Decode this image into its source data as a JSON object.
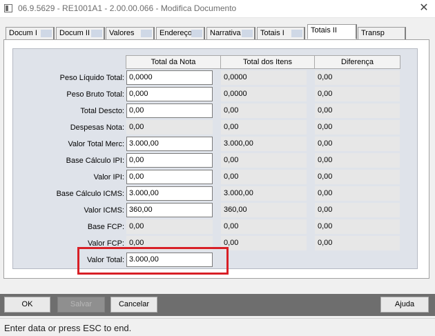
{
  "window": {
    "title": "06.9.5629 - RE1001A1 - 2.00.00.066 - Modifica Documento"
  },
  "tabs": [
    {
      "label": "Docum I"
    },
    {
      "label": "Docum II"
    },
    {
      "label": "Valores"
    },
    {
      "label": "Endereço"
    },
    {
      "label": "Narrativa"
    },
    {
      "label": "Totais I"
    },
    {
      "label": "Totais II"
    },
    {
      "label": "Transp"
    }
  ],
  "active_tab": "Totais II",
  "columns": [
    "Total da Nota",
    "Total dos Itens",
    "Diferença"
  ],
  "rows": [
    {
      "label": "Peso Líquido Total:",
      "nota": "0,0000",
      "itens": "0,0000",
      "diferenca": "0,00"
    },
    {
      "label": "Peso Bruto Total:",
      "nota": "0,000",
      "itens": "0,0000",
      "diferenca": "0,00"
    },
    {
      "label": "Total Descto:",
      "nota": "0,00",
      "itens": "0,00",
      "diferenca": "0,00"
    },
    {
      "label": "Despesas Nota:",
      "nota": "0,00",
      "itens": "0,00",
      "diferenca": "0,00"
    },
    {
      "label": "Valor Total Merc:",
      "nota": "3.000,00",
      "itens": "3.000,00",
      "diferenca": "0,00"
    },
    {
      "label": "Base Cálculo IPI:",
      "nota": "0,00",
      "itens": "0,00",
      "diferenca": "0,00"
    },
    {
      "label": "Valor IPI:",
      "nota": "0,00",
      "itens": "0,00",
      "diferenca": "0,00"
    },
    {
      "label": "Base Cálculo ICMS:",
      "nota": "3.000,00",
      "itens": "3.000,00",
      "diferenca": "0,00"
    },
    {
      "label": "Valor ICMS:",
      "nota": "360,00",
      "itens": "360,00",
      "diferenca": "0,00"
    },
    {
      "label": "Base FCP:",
      "nota": "0,00",
      "itens": "0,00",
      "diferenca": "0,00"
    },
    {
      "label": "Valor FCP:",
      "nota": "0,00",
      "itens": "0,00",
      "diferenca": "0,00"
    }
  ],
  "total": {
    "label": "Valor Total:",
    "value": "3.000,00"
  },
  "buttons": {
    "ok": "OK",
    "salvar": "Salvar",
    "cancelar": "Cancelar",
    "ajuda": "Ajuda"
  },
  "status": "Enter data or press ESC to end.",
  "colors": {
    "highlight": "#d81f26",
    "form_background": "#dfe3ea"
  }
}
